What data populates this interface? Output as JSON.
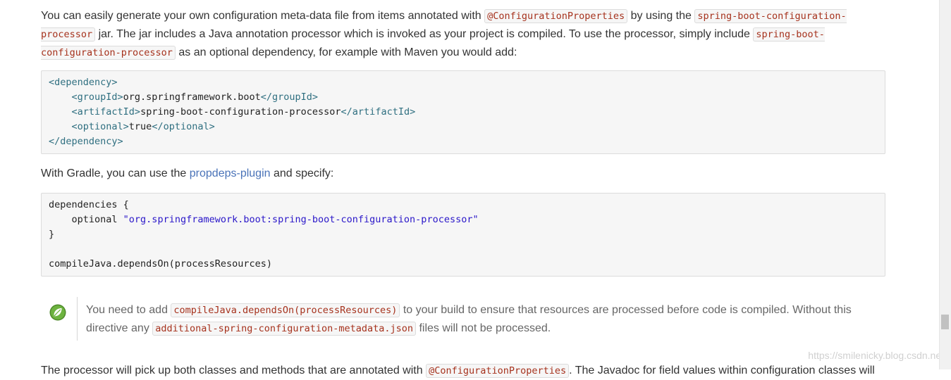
{
  "intro": {
    "t1": "You can easily generate your own configuration meta-data file from items annotated with ",
    "c1": "@ConfigurationProperties",
    "t2": " by using the ",
    "c2": "spring-boot-configuration-processor",
    "t3": " jar. The jar includes a Java annotation processor which is invoked as your project is compiled. To use the processor, simply include ",
    "c3": "spring-boot-configuration-processor",
    "t4": " as an optional dependency, for example with Maven you would add:"
  },
  "maven_code": {
    "l1_open": "<dependency>",
    "l2_open": "<groupId>",
    "l2_text": "org.springframework.boot",
    "l2_close": "</groupId>",
    "l3_open": "<artifactId>",
    "l3_text": "spring-boot-configuration-processor",
    "l3_close": "</artifactId>",
    "l4_open": "<optional>",
    "l4_text": "true",
    "l4_close": "</optional>",
    "l5_close": "</dependency>"
  },
  "gradle_intro": {
    "t1": "With Gradle, you can use the ",
    "link": "propdeps-plugin",
    "t2": " and specify:"
  },
  "gradle_code": {
    "l1": "dependencies {",
    "l2_kw": "optional ",
    "l2_str": "\"org.springframework.boot:spring-boot-configuration-processor\"",
    "l3": "}",
    "l5": "compileJava.dependsOn(processResources)"
  },
  "note": {
    "icon": "spring-leaf-icon",
    "t1": "You need to add ",
    "c1": "compileJava.dependsOn(processResources)",
    "t2": " to your build to ensure that resources are processed before code is compiled. Without this directive any ",
    "c2": "additional-spring-configuration-metadata.json",
    "t3": " files will not be processed."
  },
  "next_paragraph": {
    "t1": "The processor will pick up both classes and methods that are annotated with ",
    "c1": "@ConfigurationProperties",
    "t2": ". The Javadoc for field values within configuration classes will"
  },
  "watermark": "https://smilenicky.blog.csdn.net",
  "colors": {
    "code_bg": "#f6f6f6",
    "inline_code": "#a6321d",
    "link": "#4a73b8",
    "xml_tag": "#2f6f80",
    "string": "#2a17c9",
    "leaf_green": "#6db33f"
  }
}
